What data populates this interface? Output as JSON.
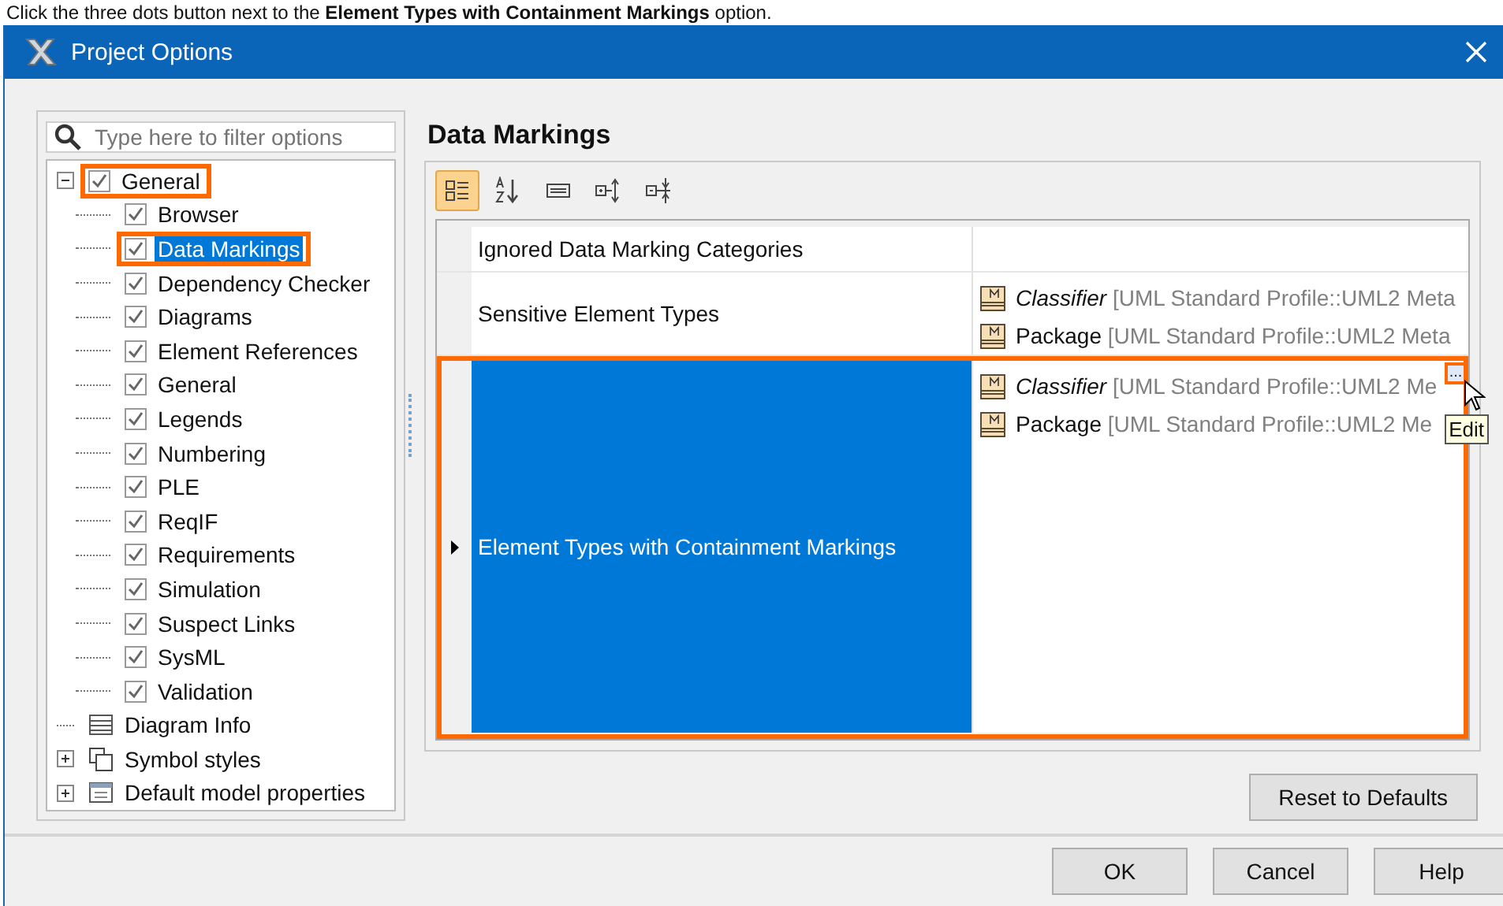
{
  "caption": "Click the three dots button next to the **Element Types with Containment Markings** option.",
  "window": {
    "title": "Project Options"
  },
  "filter": {
    "placeholder": "Type here to filter options"
  },
  "tree": [
    {
      "label": "General",
      "kind": "check",
      "checked": true,
      "expanded": true,
      "selected": false,
      "highlighted": true,
      "children": [
        {
          "label": "Browser",
          "kind": "check",
          "checked": true,
          "selected": false,
          "highlighted": false
        },
        {
          "label": "Data Markings",
          "kind": "check",
          "checked": true,
          "selected": true,
          "highlighted": true
        },
        {
          "label": "Dependency Checker",
          "kind": "check",
          "checked": true,
          "selected": false,
          "highlighted": false
        },
        {
          "label": "Diagrams",
          "kind": "check",
          "checked": true,
          "selected": false,
          "highlighted": false
        },
        {
          "label": "Element References",
          "kind": "check",
          "checked": true,
          "selected": false,
          "highlighted": false
        },
        {
          "label": "General",
          "kind": "check",
          "checked": true,
          "selected": false,
          "highlighted": false
        },
        {
          "label": "Legends",
          "kind": "check",
          "checked": true,
          "selected": false,
          "highlighted": false
        },
        {
          "label": "Numbering",
          "kind": "check",
          "checked": true,
          "selected": false,
          "highlighted": false
        },
        {
          "label": "PLE",
          "kind": "check",
          "checked": true,
          "selected": false,
          "highlighted": false
        },
        {
          "label": "ReqIF",
          "kind": "check",
          "checked": true,
          "selected": false,
          "highlighted": false
        },
        {
          "label": "Requirements",
          "kind": "check",
          "checked": true,
          "selected": false,
          "highlighted": false
        },
        {
          "label": "Simulation",
          "kind": "check",
          "checked": true,
          "selected": false,
          "highlighted": false
        },
        {
          "label": "Suspect Links",
          "kind": "check",
          "checked": true,
          "selected": false,
          "highlighted": false
        },
        {
          "label": "SysML",
          "kind": "check",
          "checked": true,
          "selected": false,
          "highlighted": false
        },
        {
          "label": "Validation",
          "kind": "check",
          "checked": true,
          "selected": false,
          "highlighted": false
        }
      ]
    },
    {
      "label": "Diagram Info",
      "kind": "list",
      "selected": false,
      "highlighted": false
    },
    {
      "label": "Symbol styles",
      "kind": "styles",
      "expanded": false,
      "selected": false,
      "highlighted": false
    },
    {
      "label": "Default model properties",
      "kind": "table",
      "expanded": false,
      "selected": false,
      "highlighted": false
    }
  ],
  "page_title": "Data Markings",
  "toolbar": [
    {
      "kind": "categorized",
      "selected": true
    },
    {
      "kind": "sort",
      "selected": false
    },
    {
      "kind": "description",
      "selected": false
    },
    {
      "kind": "expand",
      "selected": false
    },
    {
      "kind": "collapse",
      "selected": false
    }
  ],
  "properties": [
    {
      "name": "Ignored Data Marking Categories",
      "selected": false,
      "highlighted": false
    },
    {
      "name": "Sensitive Element Types",
      "selected": false,
      "highlighted": false,
      "values": [
        {
          "name": "Classifier",
          "kind": "abstract",
          "path": "[UML Standard Profile::UML2 Meta"
        },
        {
          "name": "Package",
          "kind": "concrete",
          "path": "[UML Standard Profile::UML2 Meta"
        }
      ]
    },
    {
      "name": "Element Types with Containment Markings",
      "selected": true,
      "highlighted": true,
      "values": [
        {
          "name": "Classifier",
          "kind": "abstract",
          "path": "[UML Standard Profile::UML2 Me"
        },
        {
          "name": "Package",
          "kind": "concrete",
          "path": "[UML Standard Profile::UML2 Me"
        }
      ],
      "edit_button": "...",
      "tooltip": "Edit"
    }
  ],
  "reset_button": "Reset to Defaults",
  "buttons": [
    "OK",
    "Cancel",
    "Help"
  ]
}
